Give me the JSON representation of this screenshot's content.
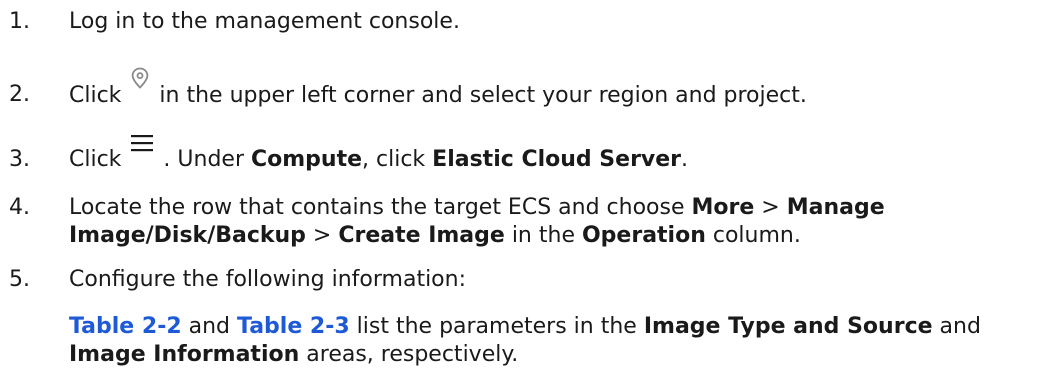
{
  "steps": [
    {
      "num": "1.",
      "text": "Log in to the management console."
    },
    {
      "num": "2.",
      "pre": "Click",
      "icon": "location-pin-icon",
      "post": "in the upper left corner and select your region and project."
    },
    {
      "num": "3.",
      "pre": "Click",
      "icon": "hamburger-menu-icon",
      "post_a": ". Under ",
      "bold_a": "Compute",
      "post_b": ", click ",
      "bold_b": "Elastic Cloud Server",
      "post_c": "."
    },
    {
      "num": "4.",
      "t1": "Locate the row that contains the target ECS and choose ",
      "b1": "More",
      "t2": " > ",
      "b2": "Manage Image/Disk/Backup",
      "t3": " > ",
      "b3": "Create Image",
      "t4": " in the ",
      "b4": "Operation",
      "t5": " column."
    },
    {
      "num": "5.",
      "text": "Configure the following information:",
      "sub": {
        "link1": "Table 2-2",
        "t1": " and ",
        "link2": "Table 2-3",
        "t2": " list the parameters in the ",
        "b1": "Image Type and Source",
        "t3": " and ",
        "b2": "Image Information",
        "t4": " areas, respectively."
      }
    }
  ],
  "colors": {
    "text": "#1a1a1a",
    "link": "#1f5ad6",
    "icon": "#8a8a8a"
  }
}
